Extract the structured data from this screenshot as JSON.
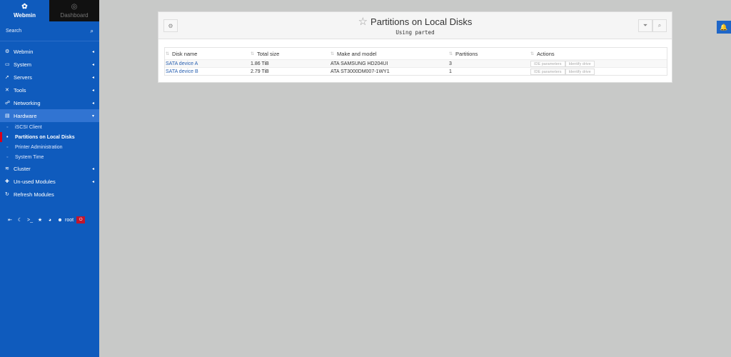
{
  "sidebar": {
    "tabs": [
      {
        "label": "Webmin",
        "icon": "webmin-logo-icon"
      },
      {
        "label": "Dashboard",
        "icon": "dashboard-icon"
      }
    ],
    "search_placeholder": "Search",
    "items": [
      {
        "label": "Webmin",
        "icon": "gear-icon"
      },
      {
        "label": "System",
        "icon": "monitor-icon"
      },
      {
        "label": "Servers",
        "icon": "rocket-icon"
      },
      {
        "label": "Tools",
        "icon": "wrench-icon"
      },
      {
        "label": "Networking",
        "icon": "network-icon"
      },
      {
        "label": "Hardware",
        "icon": "hard-drive-icon"
      }
    ],
    "hardware_subitems": [
      {
        "label": "iSCSI Client"
      },
      {
        "label": "Partitions on Local Disks"
      },
      {
        "label": "Printer Administration"
      },
      {
        "label": "System Time"
      }
    ],
    "items_after": [
      {
        "label": "Cluster",
        "icon": "database-icon"
      },
      {
        "label": "Un-used Modules",
        "icon": "puzzle-icon"
      },
      {
        "label": "Refresh Modules",
        "icon": "refresh-icon"
      }
    ],
    "bottom": {
      "user": "root"
    }
  },
  "page": {
    "title": "Partitions on Local Disks",
    "subtitle": "Using parted"
  },
  "table": {
    "headers": [
      "Disk name",
      "Total size",
      "Make and model",
      "Partitions",
      "Actions"
    ],
    "rows": [
      {
        "disk": "SATA device A",
        "size": "1.86 TiB",
        "model": "ATA SAMSUNG HD204UI",
        "partitions": "3",
        "action1": "IDE parameters",
        "action2": "Identify drive"
      },
      {
        "disk": "SATA device B",
        "size": "2.79 TiB",
        "model": "ATA ST3000DM007-1WY1",
        "partitions": "1",
        "action1": "IDE parameters",
        "action2": "Identify drive"
      }
    ]
  },
  "colors": {
    "sidebar": "#0f5bbd",
    "accent": "#d9001b",
    "link": "#2b62b1"
  }
}
